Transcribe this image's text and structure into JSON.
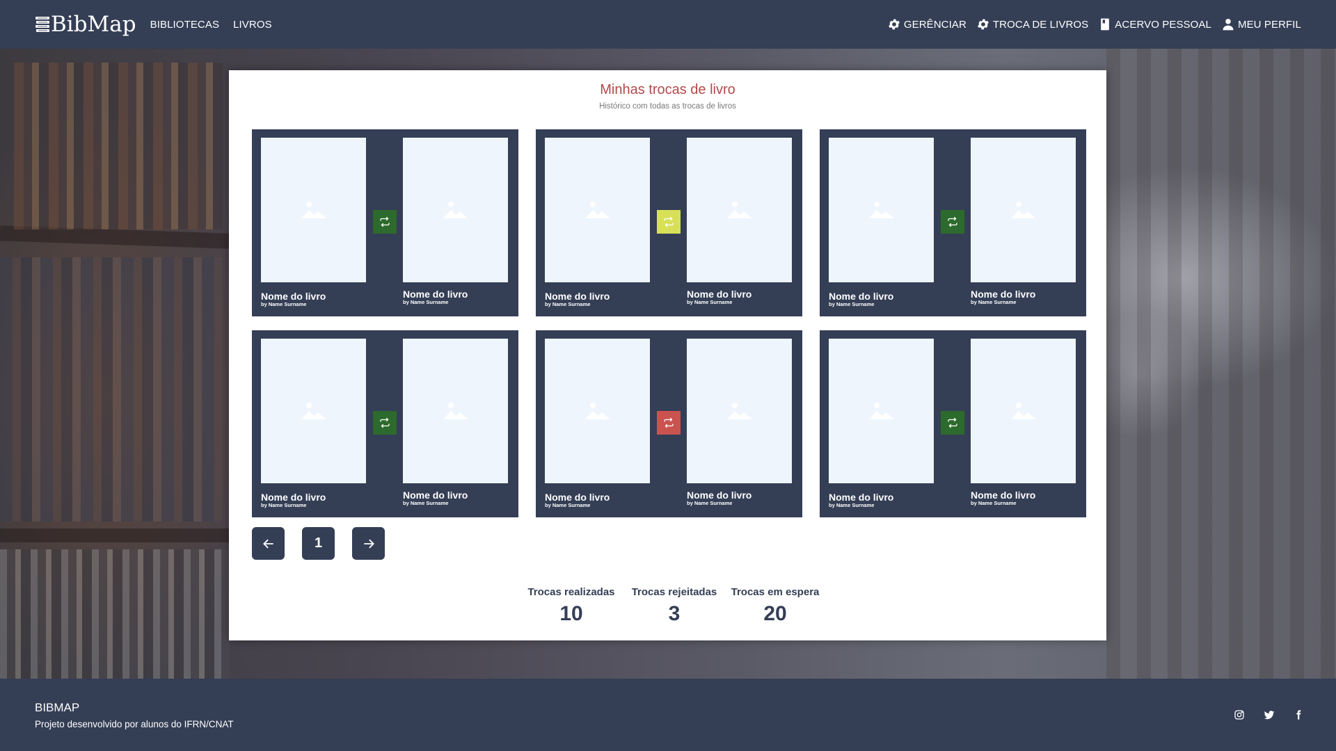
{
  "navbar": {
    "brand": "BibMap",
    "links_left": [
      "BIBLIOTECAS",
      "LIVROS"
    ],
    "links_right": [
      {
        "label": "GERÊNCIAR",
        "icon": "gear-icon"
      },
      {
        "label": "TROCA DE LIVROS",
        "icon": "gear-icon"
      },
      {
        "label": "ACERVO PESSOAL",
        "icon": "book-icon"
      },
      {
        "label": "MEU PERFIL",
        "icon": "user-icon"
      }
    ]
  },
  "main": {
    "title": "Minhas trocas de livro",
    "subtitle": "Histórico com todas as trocas de livros",
    "trades": [
      {
        "status_color": "#2d6a2d",
        "left": {
          "name": "Nome do livro",
          "author": "by Name Surname"
        },
        "right": {
          "name": "Nome do livro",
          "author": "by Name Surname"
        }
      },
      {
        "status_color": "#d8e05a",
        "left": {
          "name": "Nome do livro",
          "author": "by Name Surname"
        },
        "right": {
          "name": "Nome do livro",
          "author": "by Name Surname"
        }
      },
      {
        "status_color": "#2d6a2d",
        "left": {
          "name": "Nome do livro",
          "author": "by Name Surname"
        },
        "right": {
          "name": "Nome do livro",
          "author": "by Name Surname"
        }
      },
      {
        "status_color": "#2d6a2d",
        "left": {
          "name": "Nome do livro",
          "author": "by Name Surname"
        },
        "right": {
          "name": "Nome do livro",
          "author": "by Name Surname"
        }
      },
      {
        "status_color": "#c9534f",
        "left": {
          "name": "Nome do livro",
          "author": "by Name Surname"
        },
        "right": {
          "name": "Nome do livro",
          "author": "by Name Surname"
        }
      },
      {
        "status_color": "#2d6a2d",
        "left": {
          "name": "Nome do livro",
          "author": "by Name Surname"
        },
        "right": {
          "name": "Nome do livro",
          "author": "by Name Surname"
        }
      }
    ],
    "pagination": {
      "current_page": "1"
    },
    "stats": [
      {
        "label": "Trocas realizadas",
        "value": "10"
      },
      {
        "label": "Trocas rejeitadas",
        "value": "3"
      },
      {
        "label": "Trocas em espera",
        "value": "20"
      }
    ]
  },
  "footer": {
    "title": "BIBMAP",
    "subtitle": "Projeto desenvolvido por alunos do IFRN/CNAT",
    "social": [
      "instagram-icon",
      "twitter-icon",
      "facebook-icon"
    ]
  },
  "colors": {
    "primary": "#343e55",
    "title": "#b04a4a",
    "cover": "#eef5fd"
  }
}
